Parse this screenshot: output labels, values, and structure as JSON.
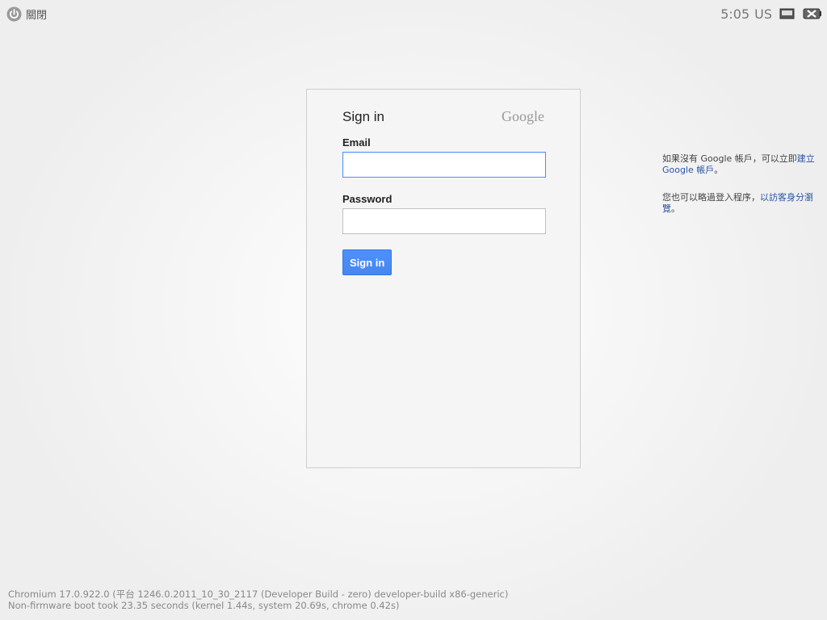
{
  "top_bar": {
    "shutdown_label": "關閉",
    "clock": "5:05",
    "input_method": "US"
  },
  "icons": {
    "shutdown": "power-icon",
    "network": "network-icon",
    "battery": "battery-icon"
  },
  "signin_card": {
    "title": "Sign in",
    "logo_text": "Google",
    "email_label": "Email",
    "email_value": "",
    "password_label": "Password",
    "password_value": "",
    "button_label": "Sign in"
  },
  "help": {
    "create_account_prefix": "如果沒有 Google 帳戶，可以立即",
    "create_account_link": "建立 Google 帳戶",
    "create_account_suffix": "。",
    "guest_prefix": "您也可以略過登入程序，",
    "guest_link": "以訪客身分瀏覽",
    "guest_suffix": "。"
  },
  "version_info": {
    "line1": "Chromium 17.0.922.0 (平台 1246.0.2011_10_30_2117 (Developer Build - zero) developer-build x86-generic)",
    "line2": "Non-firmware boot took 23.35 seconds (kernel 1.44s, system 20.69s, chrome 0.42s)"
  },
  "colors": {
    "accent": "#4d90fe",
    "link": "#2a56a5"
  }
}
